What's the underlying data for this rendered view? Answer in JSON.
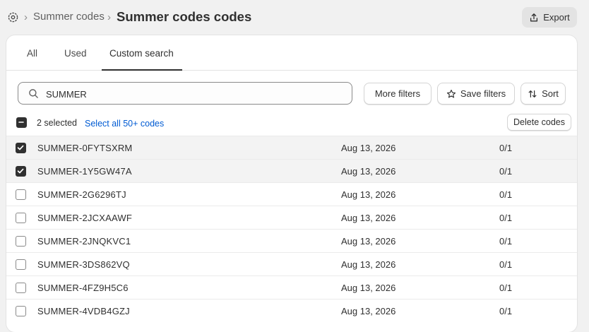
{
  "header": {
    "breadcrumb": "Summer codes",
    "title": "Summer codes codes",
    "export_label": "Export"
  },
  "tabs": [
    {
      "label": "All"
    },
    {
      "label": "Used"
    },
    {
      "label": "Custom search",
      "active": true
    }
  ],
  "search": {
    "value": "SUMMER",
    "placeholder": ""
  },
  "filters": {
    "more_filters_label": "More filters",
    "save_filters_label": "Save filters",
    "sort_label": "Sort"
  },
  "selection": {
    "count_label": "2 selected",
    "select_all_label": "Select all 50+ codes",
    "delete_label": "Delete codes"
  },
  "rows": [
    {
      "code": "SUMMER-0FYTSXRM",
      "date": "Aug 13, 2026",
      "usage": "0/1",
      "checked": true
    },
    {
      "code": "SUMMER-1Y5GW47A",
      "date": "Aug 13, 2026",
      "usage": "0/1",
      "checked": true
    },
    {
      "code": "SUMMER-2G6296TJ",
      "date": "Aug 13, 2026",
      "usage": "0/1",
      "checked": false
    },
    {
      "code": "SUMMER-2JCXAAWF",
      "date": "Aug 13, 2026",
      "usage": "0/1",
      "checked": false
    },
    {
      "code": "SUMMER-2JNQKVC1",
      "date": "Aug 13, 2026",
      "usage": "0/1",
      "checked": false
    },
    {
      "code": "SUMMER-3DS862VQ",
      "date": "Aug 13, 2026",
      "usage": "0/1",
      "checked": false
    },
    {
      "code": "SUMMER-4FZ9H5C6",
      "date": "Aug 13, 2026",
      "usage": "0/1",
      "checked": false
    },
    {
      "code": "SUMMER-4VDB4GZJ",
      "date": "Aug 13, 2026",
      "usage": "0/1",
      "checked": false
    }
  ],
  "icons": {
    "settings": "settings-icon",
    "export": "export-icon",
    "search": "search-icon",
    "save": "star-icon",
    "sort": "sort-icon"
  },
  "colors": {
    "link": "#005bd3",
    "checkbox_fill": "#303030",
    "selected_row": "#f3f3f3"
  }
}
